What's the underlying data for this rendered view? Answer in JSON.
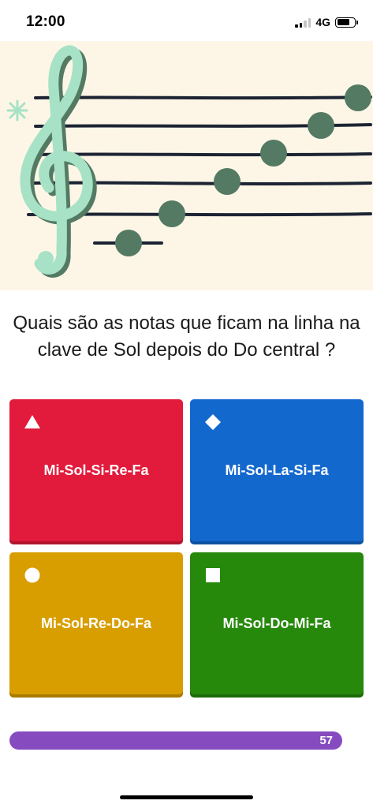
{
  "status_bar": {
    "time": "12:00",
    "network": "4G",
    "icons": [
      "signal-icon",
      "battery-icon"
    ]
  },
  "illustration": {
    "description_icon": "treble-clef-staff-icon",
    "colors": {
      "background": "#fdf6e7",
      "staff_lines": "#1c2333",
      "notes": "#547a63",
      "clef": "#a7e2c6",
      "clef_shadow": "#547a63"
    }
  },
  "question": {
    "text": "Quais são as notas que ficam na linha na clave de Sol depois do Do central ?"
  },
  "answers": [
    {
      "label": "Mi-Sol-Si-Re-Fa",
      "shape": "triangle-icon",
      "color": "#e21b3c"
    },
    {
      "label": "Mi-Sol-La-Si-Fa",
      "shape": "diamond-icon",
      "color": "#1368ce"
    },
    {
      "label": "Mi-Sol-Re-Do-Fa",
      "shape": "circle-icon",
      "color": "#d89e00"
    },
    {
      "label": "Mi-Sol-Do-Mi-Fa",
      "shape": "square-icon",
      "color": "#26890c"
    }
  ],
  "progress": {
    "value": "57",
    "color": "#864cbf"
  }
}
